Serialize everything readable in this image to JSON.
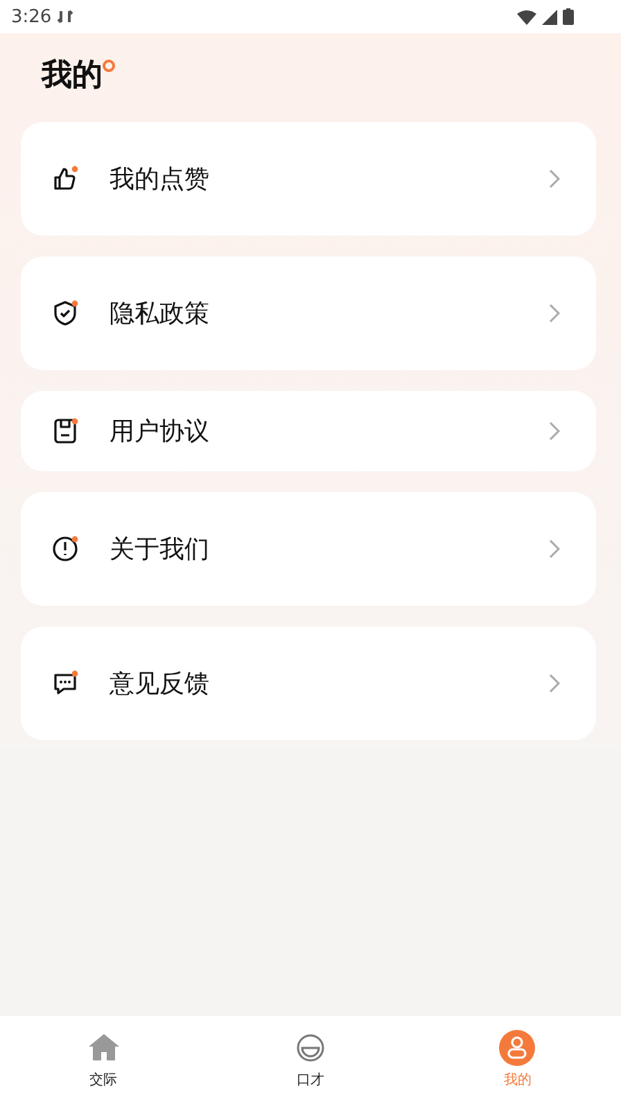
{
  "status_bar": {
    "time": "3:26"
  },
  "title": "我的",
  "menu": [
    {
      "label": "我的点赞",
      "kind": "thumb",
      "compact": false
    },
    {
      "label": "隐私政策",
      "kind": "shield",
      "compact": false
    },
    {
      "label": "用户协议",
      "kind": "doc",
      "compact": true
    },
    {
      "label": "关于我们",
      "kind": "info",
      "compact": false
    },
    {
      "label": "意见反馈",
      "kind": "chat",
      "compact": false
    }
  ],
  "tabs": [
    {
      "label": "交际",
      "kind": "home",
      "selected": false
    },
    {
      "label": "口才",
      "kind": "face",
      "selected": false
    },
    {
      "label": "我的",
      "kind": "person",
      "selected": true
    }
  ]
}
